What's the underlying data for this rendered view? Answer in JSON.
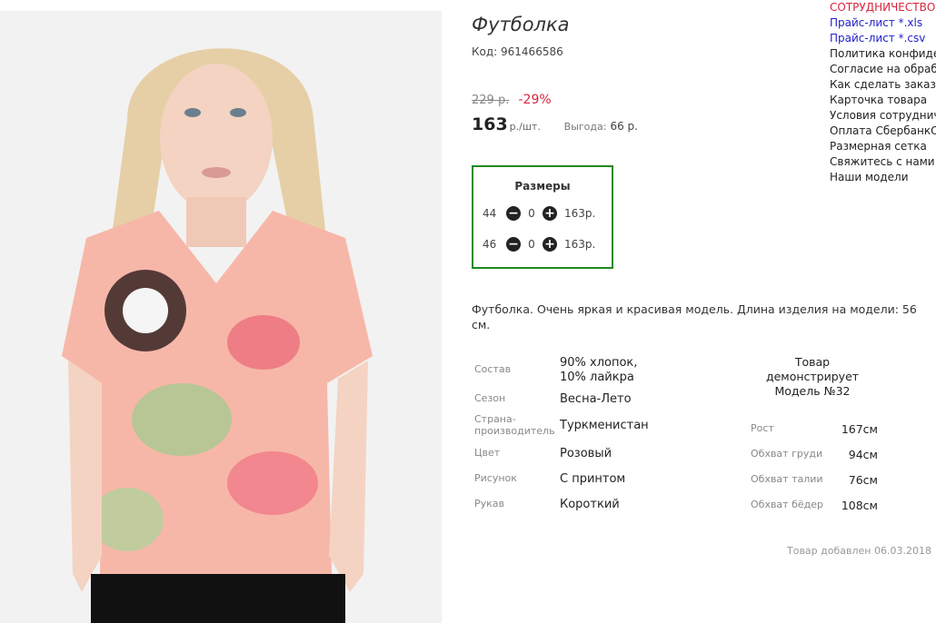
{
  "product": {
    "title": "Футболка",
    "code": "Код: 961466586",
    "old_price": "229 р.",
    "discount": "-29%",
    "price": "163",
    "price_unit": "р./шт.",
    "benefit_label": "Выгода:",
    "benefit_value": "66 р."
  },
  "sizes": {
    "title": "Размеры",
    "rows": [
      {
        "size": "44",
        "qty": "0",
        "sum": "163р."
      },
      {
        "size": "46",
        "qty": "0",
        "sum": "163р."
      }
    ],
    "minus_icon": "minus-circle-icon",
    "plus_icon": "plus-circle-icon"
  },
  "description": "Футболка. Очень яркая и красивая модель. Длина изделия на модели: 56 см.",
  "attributes": [
    {
      "label": "Состав",
      "value": "90% хлопок, 10% лайкра"
    },
    {
      "label": "Сезон",
      "value": "Весна-Лето"
    },
    {
      "label": "Страна-производитель",
      "value": "Туркменистан"
    },
    {
      "label": "Цвет",
      "value": "Розовый"
    },
    {
      "label": "Рисунок",
      "value": "С принтом"
    },
    {
      "label": "Рукав",
      "value": "Короткий"
    }
  ],
  "model": {
    "heading": "Товар демонстрирует Модель №32",
    "rows": [
      {
        "label": "Рост",
        "value": "167см"
      },
      {
        "label": "Обхват груди",
        "value": "94см"
      },
      {
        "label": "Обхват талии",
        "value": "76см"
      },
      {
        "label": "Обхват бёдер",
        "value": "108см"
      }
    ]
  },
  "added": "Товар добавлен 06.03.2018",
  "sidebar": {
    "links": [
      "СОТРУДНИЧЕСТВО",
      "Прайс-лист *.xls",
      "Прайс-лист *.csv",
      "Политика конфиденциальности",
      "Согласие на обработку персональных данных",
      "Как сделать заказ",
      "Карточка товара",
      "Условия сотрудничества",
      "Оплата СбербанкОнлайн",
      "Размерная сетка",
      "Свяжитесь с нами",
      "Наши модели"
    ]
  },
  "colors": {
    "accent_red": "#d8263e",
    "size_box_border": "#1e8b1e",
    "link_blue": "#2222cc"
  }
}
